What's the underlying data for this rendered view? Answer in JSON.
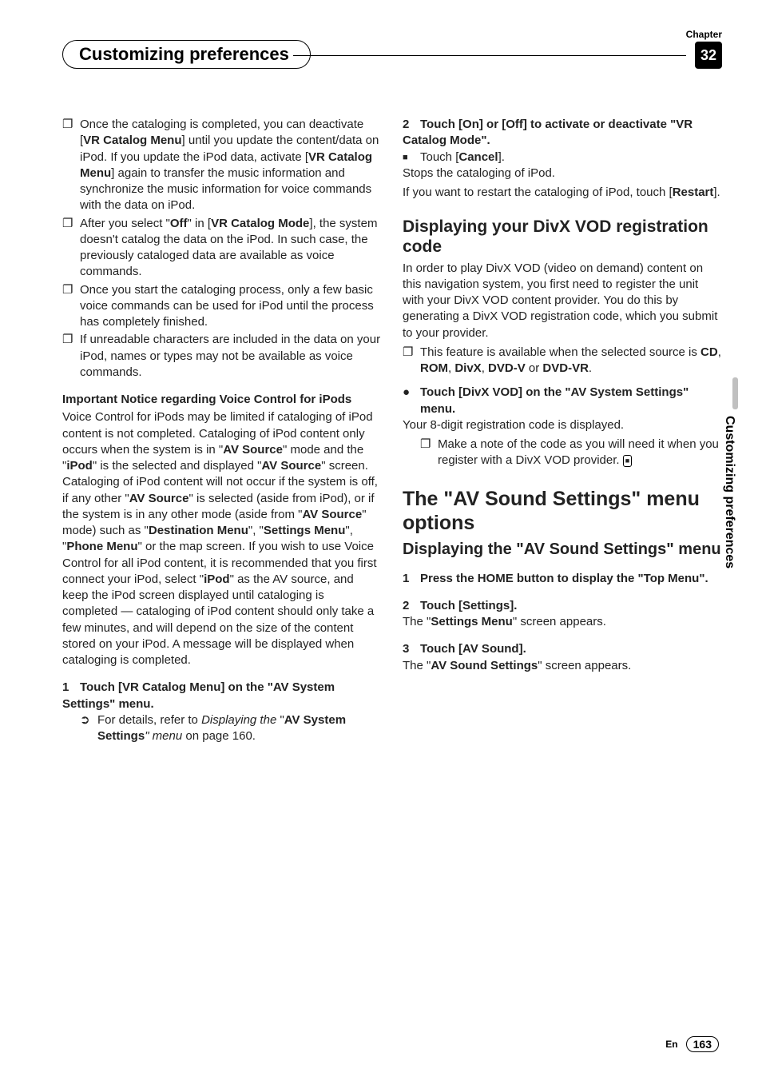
{
  "header": {
    "chapter_label": "Chapter",
    "chapter_number": "32",
    "title": "Customizing preferences"
  },
  "side_tab": "Customizing preferences",
  "left": {
    "notes": [
      {
        "text_before": "Once the cataloging is completed, you can deactivate [",
        "bold1": "VR Catalog Menu",
        "mid1": "] until you update the content/data on iPod. If you update the iPod data, activate [",
        "bold2": "VR Catalog Menu",
        "after": "] again to transfer the music information and synchronize the music information for voice commands with the data on iPod."
      },
      {
        "text_before": "After you select \"",
        "bold1": "Off",
        "mid1": "\" in [",
        "bold2": "VR Catalog Mode",
        "after": "], the system doesn't catalog the data on the iPod. In such case, the previously cataloged data are available as voice commands."
      },
      {
        "plain": "Once you start the cataloging process, only a few basic voice commands can be used for iPod until the process has completely finished."
      },
      {
        "plain": "If unreadable characters are included in the data on your iPod, names or types may not be available as voice commands."
      }
    ],
    "notice_heading": "Important Notice regarding Voice Control for iPods",
    "notice_body": {
      "p1": "Voice Control for iPods may be limited if cataloging of iPod content is not completed. Cataloging of iPod content only occurs when the system is in \"",
      "b1": "AV Source",
      "p2": "\" mode and the \"",
      "b2": "iPod",
      "p3": "\" is the selected and displayed \"",
      "b3": "AV Source",
      "p4": "\" screen. Cataloging of iPod content will not occur if the system is off, if any other \"",
      "b4": "AV Source",
      "p5": "\" is selected  (aside from iPod), or if the system is in any other mode (aside from \"",
      "b5": "AV Source",
      "p6": "\" mode) such as \"",
      "b6": "Destination Menu",
      "p7": "\", \"",
      "b7": "Settings Menu",
      "p8": "\", \"",
      "b8": "Phone Menu",
      "p9": "\" or the map screen. If you wish to use Voice Control for all iPod content, it is recommended that you first connect your iPod, select \"",
      "b9": "iPod",
      "p10": "\" as the AV source, and keep the iPod screen displayed until cataloging is completed — cataloging of iPod content should only take a few minutes, and will depend on the size of the content stored on your iPod. A message will be displayed when cataloging is completed."
    },
    "step1": {
      "num": "1",
      "text": "Touch [VR Catalog Menu] on the \"AV System Settings\" menu."
    },
    "ref1": {
      "lead": "For details, refer to ",
      "ital1": "Displaying the ",
      "quote": "\"",
      "b1": "AV System Settings",
      "ital2": "\" menu",
      "tail": " on page 160."
    }
  },
  "right": {
    "step2": {
      "num": "2",
      "text": "Touch [On] or [Off] to activate or deactivate \"VR Catalog Mode\"."
    },
    "cancel": {
      "lead": "Touch [",
      "b": "Cancel",
      "tail": "]."
    },
    "cancel_body1": "Stops the cataloging of iPod.",
    "cancel_body2_lead": "If you want to restart the cataloging of iPod, touch [",
    "cancel_body2_b": "Restart",
    "cancel_body2_tail": "].",
    "divx_heading": "Displaying your DivX VOD registration code",
    "divx_body": "In order to play DivX VOD (video on demand) content on this navigation system, you first need to register the unit with your DivX VOD content provider. You do this by generating a DivX VOD registration code, which you submit to your provider.",
    "divx_note": {
      "lead": "This feature is available when the selected source is ",
      "b1": "CD",
      "c1": ", ",
      "b2": "ROM",
      "c2": ", ",
      "b3": "DivX",
      "c3": ", ",
      "b4": "DVD-V",
      "c4": " or ",
      "b5": "DVD-VR",
      "tail": "."
    },
    "divx_step": "Touch [DivX VOD] on the \"AV System Settings\" menu.",
    "divx_result": "Your 8-digit registration code is displayed.",
    "divx_subnote": "Make a note of the code as you will need it when you register with a DivX VOD provider.",
    "avs_heading": "The \"AV Sound Settings\" menu options",
    "avs_sub": "Displaying the \"AV Sound Settings\" menu",
    "avs_step1": {
      "num": "1",
      "text": "Press the HOME button to display the \"Top Menu\"."
    },
    "avs_step2": {
      "num": "2",
      "text": "Touch [Settings]."
    },
    "avs_step2_body": {
      "lead": "The \"",
      "b": "Settings Menu",
      "tail": "\" screen appears."
    },
    "avs_step3": {
      "num": "3",
      "text": "Touch [AV Sound]."
    },
    "avs_step3_body": {
      "lead": "The \"",
      "b": "AV Sound Settings",
      "tail": "\" screen appears."
    }
  },
  "footer": {
    "lang": "En",
    "page": "163"
  }
}
